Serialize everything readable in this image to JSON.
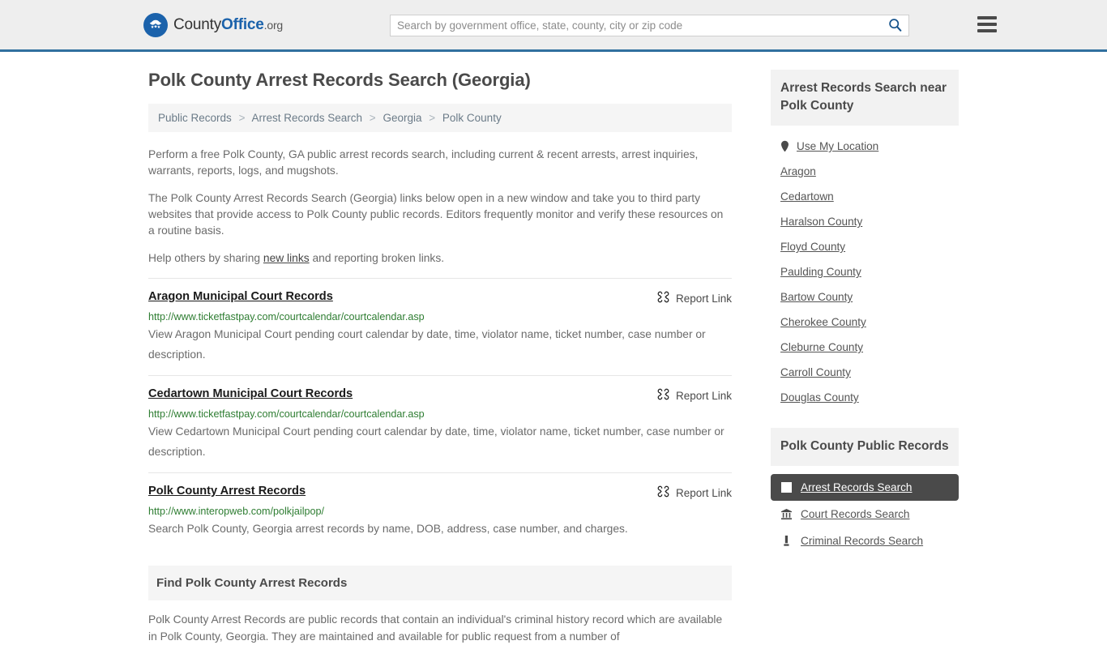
{
  "header": {
    "logo_county": "County",
    "logo_office": "Office",
    "logo_org": ".org",
    "logo_icon": "eagle-shield-logo",
    "search_placeholder": "Search by government office, state, county, city or zip code",
    "search_value": "",
    "search_icon": "search-icon",
    "menu_icon": "hamburger-menu-icon",
    "accent_color": "#31709f"
  },
  "main": {
    "title": "Polk County Arrest Records Search (Georgia)",
    "breadcrumb": [
      "Public Records",
      "Arrest Records Search",
      "Georgia",
      "Polk County"
    ],
    "breadcrumb_separator": ">",
    "intro": [
      "Perform a free Polk County, GA public arrest records search, including current & recent arrests, arrest inquiries, warrants, reports, logs, and mugshots.",
      "The Polk County Arrest Records Search (Georgia) links below open in a new window and take you to third party websites that provide access to Polk County public records. Editors frequently monitor and verify these resources on a routine basis."
    ],
    "help_prefix": "Help others by sharing ",
    "help_link": "new links",
    "help_suffix": " and reporting broken links.",
    "report_link_label": "Report Link",
    "report_link_icon": "broken-link-icon",
    "results": [
      {
        "title": "Aragon Municipal Court Records",
        "url": "http://www.ticketfastpay.com/courtcalendar/courtcalendar.asp",
        "description": "View Aragon Municipal Court pending court calendar by date, time, violator name, ticket number, case number or description."
      },
      {
        "title": "Cedartown Municipal Court Records",
        "url": "http://www.ticketfastpay.com/courtcalendar/courtcalendar.asp",
        "description": "View Cedartown Municipal Court pending court calendar by date, time, violator name, ticket number, case number or description."
      },
      {
        "title": "Polk County Arrest Records",
        "url": "http://www.interopweb.com/polkjailpop/",
        "description": "Search Polk County, Georgia arrest records by name, DOB, address, case number, and charges."
      }
    ],
    "find_section": {
      "heading": "Find Polk County Arrest Records",
      "body": "Polk County Arrest Records are public records that contain an individual's criminal history record which are available in Polk County, Georgia. They are maintained and available for public request from a number of"
    }
  },
  "sidebar": {
    "near_heading": "Arrest Records Search near Polk County",
    "use_my_location": "Use My Location",
    "location_icon": "map-pin-icon",
    "nearby": [
      "Aragon",
      "Cedartown",
      "Haralson County",
      "Floyd County",
      "Paulding County",
      "Bartow County",
      "Cherokee County",
      "Cleburne County",
      "Carroll County",
      "Douglas County"
    ],
    "public_records_heading": "Polk County Public Records",
    "public_records": [
      {
        "label": "Arrest Records Search",
        "icon": "square-icon",
        "active": true
      },
      {
        "label": "Court Records Search",
        "icon": "courthouse-icon",
        "active": false
      },
      {
        "label": "Criminal Records Search",
        "icon": "gavel-icon",
        "active": false
      }
    ],
    "active_bg": "#4a4a4a"
  }
}
